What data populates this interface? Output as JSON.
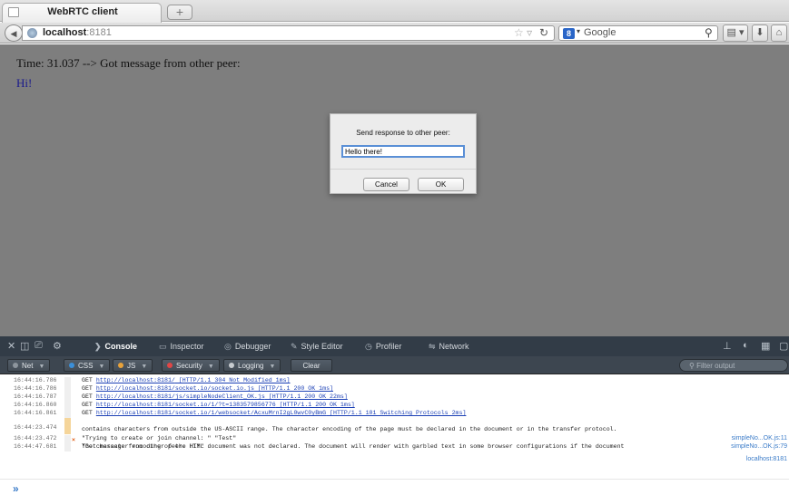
{
  "browser": {
    "tab_title": "WebRTC client",
    "new_tab_label": "+",
    "url_host": "localhost",
    "url_port": ":8181",
    "search_placeholder": "Google"
  },
  "page": {
    "message_line": "Time: 31.037 --> Got message from other peer:",
    "message_text": "Hi!"
  },
  "dialog": {
    "title": "Send response to other peer:",
    "input_value": "Hello there!",
    "cancel_label": "Cancel",
    "ok_label": "OK"
  },
  "devtools": {
    "tabs": {
      "console": "Console",
      "inspector": "Inspector",
      "debugger": "Debugger",
      "style_editor": "Style Editor",
      "profiler": "Profiler",
      "network": "Network"
    },
    "filters": {
      "net": "Net",
      "css": "CSS",
      "js": "JS",
      "security": "Security",
      "logging": "Logging",
      "clear": "Clear",
      "filter_placeholder": "Filter output"
    },
    "colors": {
      "css_dot": "#3b8fd9",
      "js_dot": "#e8a23a",
      "security_dot": "#e04646",
      "logging_dot": "#c8ccd0",
      "net_dot": "#8d959d"
    },
    "log": [
      {
        "time": "16:44:16.786",
        "prefix": "GET ",
        "url": "http://localhost:8181/",
        "suffix": " [HTTP/1.1 304 Not Modified 1ms]"
      },
      {
        "time": "16:44:16.786",
        "prefix": "GET ",
        "url": "http://localhost:8181/socket.io/socket.io.js",
        "suffix": " [HTTP/1.1 200 OK 1ms]"
      },
      {
        "time": "16:44:16.787",
        "prefix": "GET ",
        "url": "http://localhost:8181/js/simpleNodeClient_OK.js",
        "suffix": " [HTTP/1.1 200 OK 22ms]"
      },
      {
        "time": "16:44:16.860",
        "prefix": "GET ",
        "url": "http://localhost:8181/socket.io/1/?t=1383579856776",
        "suffix": " [HTTP/1.1 200 OK 1ms]"
      },
      {
        "time": "16:44:16.861",
        "prefix": "GET ",
        "url": "http://localhost:8181/socket.io/1/websocket/AcxuMrnI2gL0wvC0yBmG",
        "suffix": " [HTTP/1.1 101 Switching Protocols 2ms]"
      }
    ],
    "warning": {
      "time": "16:44:23.474",
      "line1": "The character encoding of the HTML document was not declared. The document will render with garbled text in some browser configurations if the document",
      "line2": "contains characters from outside the US-ASCII range. The character encoding of the page must be declared in the document or in the transfer protocol.",
      "source": "localhost:8181"
    },
    "messages": [
      {
        "time": "16:44:23.472",
        "text": "\"Trying to create or join channel: \" \"Test\"",
        "source": "simpleNo...OK.js:11"
      },
      {
        "time": "16:44:47.681",
        "text": "\"Got message from other peer: Hi!\"",
        "source": "simpleNo...OK.js:79"
      }
    ],
    "prompt": "»"
  }
}
